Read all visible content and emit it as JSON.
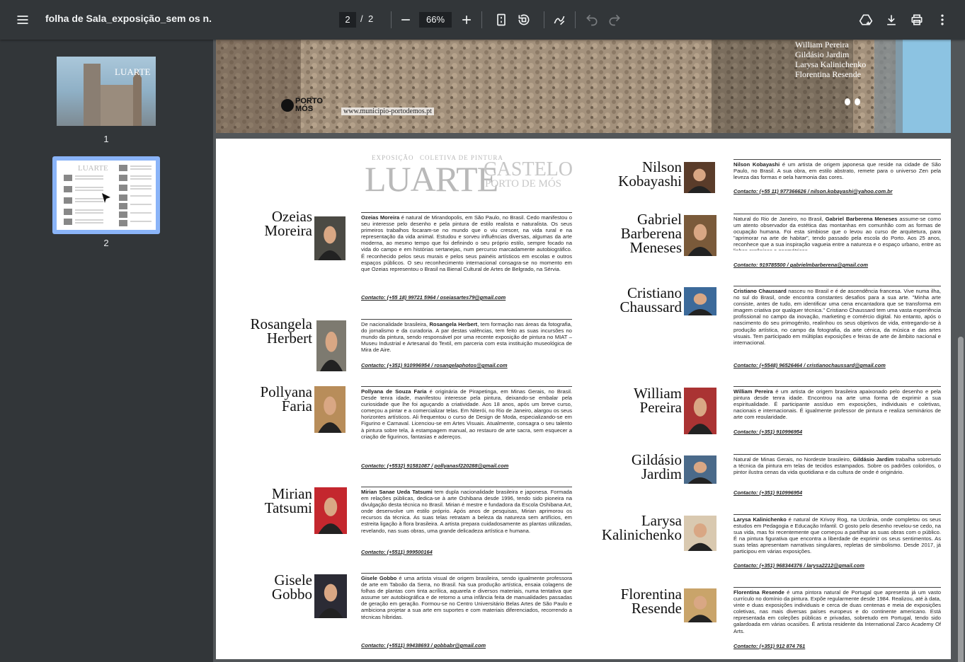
{
  "toolbar": {
    "title": "folha de Sala_exposição_sem os n.",
    "page_current": "2",
    "page_sep": "/",
    "page_total": "2",
    "zoom": "66%"
  },
  "thumbnails": [
    {
      "num": "1"
    },
    {
      "num": "2"
    }
  ],
  "page1": {
    "artist_names": [
      "William Pereira",
      "Gildásio Jardim",
      "Larysa Kalinichenko",
      "Florentina Resende"
    ],
    "url": "www.municipio-portodemos.pt",
    "logo": "PORTO MÓS"
  },
  "header": {
    "expo": "EXPOSIÇÃO",
    "coletiva": "COLETIVA DE PINTURA",
    "luarte": "LUARTE",
    "castelo": "CASTELO",
    "porto": "PORTO DE MÓS"
  },
  "artists_left": [
    {
      "name1": "Ozeias",
      "name2": "Moreira",
      "bold": "Ozeias Moreira",
      "bio": " é natural de Mirandopolis, em São Paulo, no Brasil. Cedo manifestou o seu interesse pelo desenho e pela pintura de estilo realista e naturalista. Os seus primeiros trabalhos focaram-se no mundo que o viu crescer, na vida rural e na representação da vida animal. Estudou e sorveu influências diversas, algumas da arte moderna, ao mesmo tempo que foi definindo o seu próprio estilo, sempre focado na vida do campo e em histórias sertanejas, num percurso marcadamente autobiográfico. É reconhecido pelos seus murais e pelos seus painéis artísticos em escolas e outros espaços públicos. O seu reconhecimento internacional consagra-se no momento em que Ozeias representou o Brasil na Bienal Cultural de Artes de Belgrado, na Sérvia.",
      "contact": "Contacto: (+55 18) 99721 5964 / oseiasartes79@gmail.com"
    },
    {
      "name1": "Rosangela",
      "name2": "Herbert",
      "bold": "Rosangela Herbert",
      "bio_pre": "De nacionalidade brasileira, ",
      "bio": ", tem formação nas áreas da fotografia, do jornalismo e da curadoria. A par destas valências, tem feito as suas incursões no mundo da pintura, sendo responsável por uma recente exposição de pintura no MIAT – Museu Industrial e Artesanal do Textil, em parceria com esta instituição museológica de Mira de Aire.",
      "contact": "Contacto: (+351) 910996954 / rosangelaphotos@gmail.com"
    },
    {
      "name1": "Pollyana",
      "name2": "Faria",
      "bold": "Pollyana de Souza Faria",
      "bio": " é originária de Pirapetinga, em Minas Gerais, no Brasil. Desde tenra idade, manifestou interesse pela pintura, deixando-se embalar pela curiosidade que lhe foi aguçando a criatividade. Aos 18 anos, após um breve curso, começou a pintar e a comercializar telas. Em Niterói, no Rio de Janeiro, alargou os seus horizontes artísticos. Ali frequentou o curso de Design de Moda, especializando-se em Figurino e Carnaval. Licenciou-se em Artes Visuais. Atualmente, consagra o seu talento à pintura sobre tela, à estampagem manual, ao restauro de arte sacra, sem esquecer a criação de figurinos, fantasias e adereços.",
      "contact": "Contacto: (+5532) 91581087 / pollyanasf220288@gmail.com"
    },
    {
      "name1": "Mirian",
      "name2": "Tatsumi",
      "bold": "Mirian Sanae Ueda Tatsumi",
      "bio": " tem dupla nacionalidade brasileira e japonesa. Formada em relações públicas, dedica-se à arte Oshibana desde 1996, tendo sido pioneira na divulgação desta técnica no Brasil. Mirian é mestre e fundadora da Escola Oshibana Art, onde desenvolve um estilo próprio. Após anos de pesquisas, Mirian aprimorou os recursos da técnica. As suas telas retratam a beleza da natureza sem artifícios, em estreita ligação à flora brasileira. A artista prepara cuidadosamente as plantas utilizadas, revelando, nas suas obras, uma grande delicadeza artística e humana.",
      "contact": "Contacto: (+5511) 999500164"
    },
    {
      "name1": "Gisele",
      "name2": "Gobbo",
      "bold": "Gisele Gobbo",
      "bio": " é uma artista visual de origem brasileira, sendo igualmente professora de arte em Taboão da Serra, no Brasil. Na sua produção artística, ensaia colagens de folhas de plantas com tinta acrílica, aquarela e diversos materiais, numa tentativa que assume ser autobiográfica e de retorno a uma infância feita de manualidades passadas de geração em geração. Formou-se no Centro Universitário Belas Artes de São Paulo e ambiciona projetar a sua arte em suportes e com materiais diferenciados, recorrendo a técnicas híbridas.",
      "contact": "Contacto: (+5511) 99438693 / gobbabr@gmail.com"
    }
  ],
  "artists_right": [
    {
      "name1": "Nilson",
      "name2": "Kobayashi",
      "bold": "Nilson Kobayashi",
      "bio": " é um artista de origem japonesa que reside na cidade de São Paulo, no Brasil. A sua obra, em estilo abstrato, remete para o universo Zen pela leveza das formas e pela harmonia das cores.",
      "contact": "Contacto: (+55 11) 977366626 / nilson.kobayashi@yahoo.com.br"
    },
    {
      "name1": "Gabriel",
      "name2": "Barberena",
      "name3": "Meneses",
      "bold": "Gabriel Barberena Meneses",
      "bio_pre": "Natural do Rio de Janeiro, no Brasil, ",
      "bio": " assume-se como um atento observador da estética das montanhas em comunhão com as formas de ocupação humana. Foi esta simbiose que o levou ao curso de arquitetura, para \"aprimorar na arte de habitar\", tendo passado pela escola do Porto. Aos 25 anos, reconhece que a sua inspiração vagueia entre a natureza e o espaço urbano, entre as linhas orgânicas e geométricas.",
      "contact": "Contacto: 919785500 / gabrielmbarberena@gmail.com"
    },
    {
      "name1": "Cristiano",
      "name2": "Chaussard",
      "bold": "Cristiano Chaussard",
      "bio": " nasceu no Brasil e é de ascendência francesa. Vive numa ilha, no sul do Brasil, onde encontra constantes desafios para a sua arte. \"Minha arte consiste, antes de tudo, em identificar uma cena encantadora que se transforma em imagem criativa por qualquer técnica.\" Cristiano Chaussard tem uma vasta experiência profissional no campo da inovação, marketing e comércio digital. No entanto, após o nascimento do seu primogénito, realinhou os seus objetivos de vida, entregando-se à produção artística, no campo da fotografia, da arte cénica, da música e das artes visuais. Tem participado em múltiplas exposições e feiras de arte de âmbito nacional e internacional.",
      "contact": "Contacto: (+5548) 96526464 / cristianochaussard@gmail.com"
    },
    {
      "name1": "William",
      "name2": "Pereira",
      "bold": "William Pereira",
      "bio": " é um artista de origem brasileira apaixonado pelo desenho e pela pintura desde tenra idade. Encontrou na arte uma forma de exprimir a sua espiritualidade. É participante assíduo em exposições, individuais e coletivas, nacionais e internacionais. É igualmente professor de pintura e realiza seminários de arte com regularidade.",
      "contact": "Contacto: (+351) 910996954"
    },
    {
      "name1": "Gildásio",
      "name2": "Jardim",
      "bold": "Gildásio Jardim",
      "bio_pre": "Natural de Minas Gerais, no Nordeste brasileiro, ",
      "bio": " trabalha sobretudo a técnica da pintura em telas de tecidos estampados. Sobre os padrões coloridos, o pintor ilustra cenas da vida quotidiana e da cultura de onde é originário.",
      "contact": "Contacto: (+351) 910996954"
    },
    {
      "name1": "Larysa",
      "name2": "Kalinichenko",
      "bold": "Larysa Kalinichenko",
      "bio": " é natural de Krivoy Rog, na Ucrânia, onde completou os seus estudos em Pedagogia e Educação Infantil. O gosto pelo desenho revelou-se cedo, na sua vida, mas foi recentemente que começou a partilhar as suas obras com o público. É na pintura figurativa que encontra a liberdade de exprimir os seus sentimentos. As suas telas apresentam narrativas singulares, repletas de simbolismo. Desde 2017, já participou em várias exposições.",
      "contact": "Contacto: (+351) 968344376 / larysa2212@gmail.com"
    },
    {
      "name1": "Florentina",
      "name2": "Resende",
      "bold": "Florentina Resende",
      "bio": " é uma pintora natural de Portugal que apresenta já um vasto currículo no domínio da pintura. Expõe regularmente desde 1984. Realizou, até à data, vinte e duas exposições individuais e cerca de duas centenas e meia de exposições coletivas, nas mais diversas países europeus e do continente americano. Está representada em coleções públicas e privadas, sobretudo em Portugal, tendo sido galardoada em várias ocasiões. É artista residente da International Zarco Academy Of Arts.",
      "contact": "Contacto: (+351) 912 874 761"
    }
  ],
  "colors": {
    "toolbar": "#323639",
    "viewer_bg": "#525659",
    "accent": "#8ab4f8"
  }
}
